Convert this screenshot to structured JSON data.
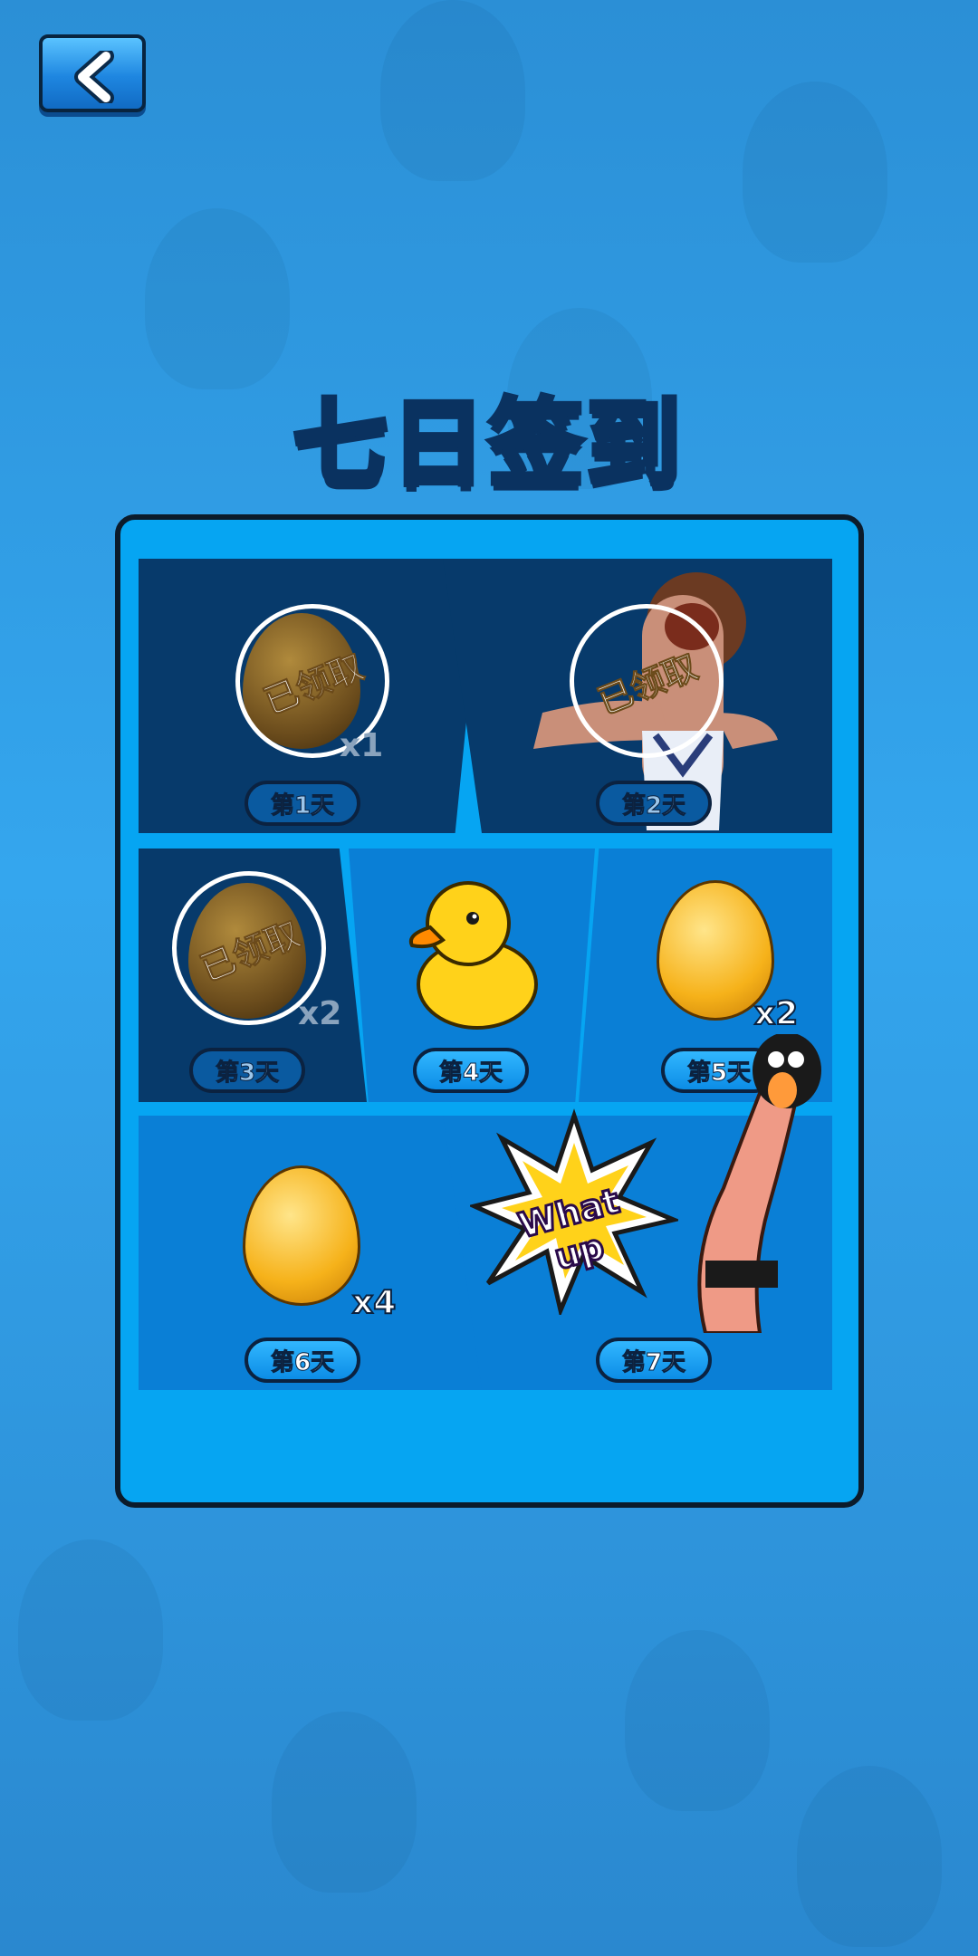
{
  "header": {
    "title": "七日签到"
  },
  "back_button": {
    "icon": "chevron-left-icon"
  },
  "days": [
    {
      "label": "第1天",
      "qty": "x1",
      "stamp": "已领取",
      "reward": "brown-egg"
    },
    {
      "label": "第2天",
      "stamp": "已领取",
      "reward": "character-skin"
    },
    {
      "label": "第3天",
      "qty": "x2",
      "stamp": "已领取",
      "reward": "brown-egg"
    },
    {
      "label": "第4天",
      "reward": "rubber-duck"
    },
    {
      "label": "第5天",
      "qty": "x2",
      "reward": "golden-egg"
    },
    {
      "label": "第6天",
      "qty": "x4",
      "reward": "golden-egg"
    },
    {
      "label": "第7天",
      "reward": "character-skin",
      "burst_text": "What up"
    }
  ],
  "colors": {
    "claimed": "#073a6b",
    "open": "#0a7fd6",
    "panel": "#06a5f2"
  }
}
